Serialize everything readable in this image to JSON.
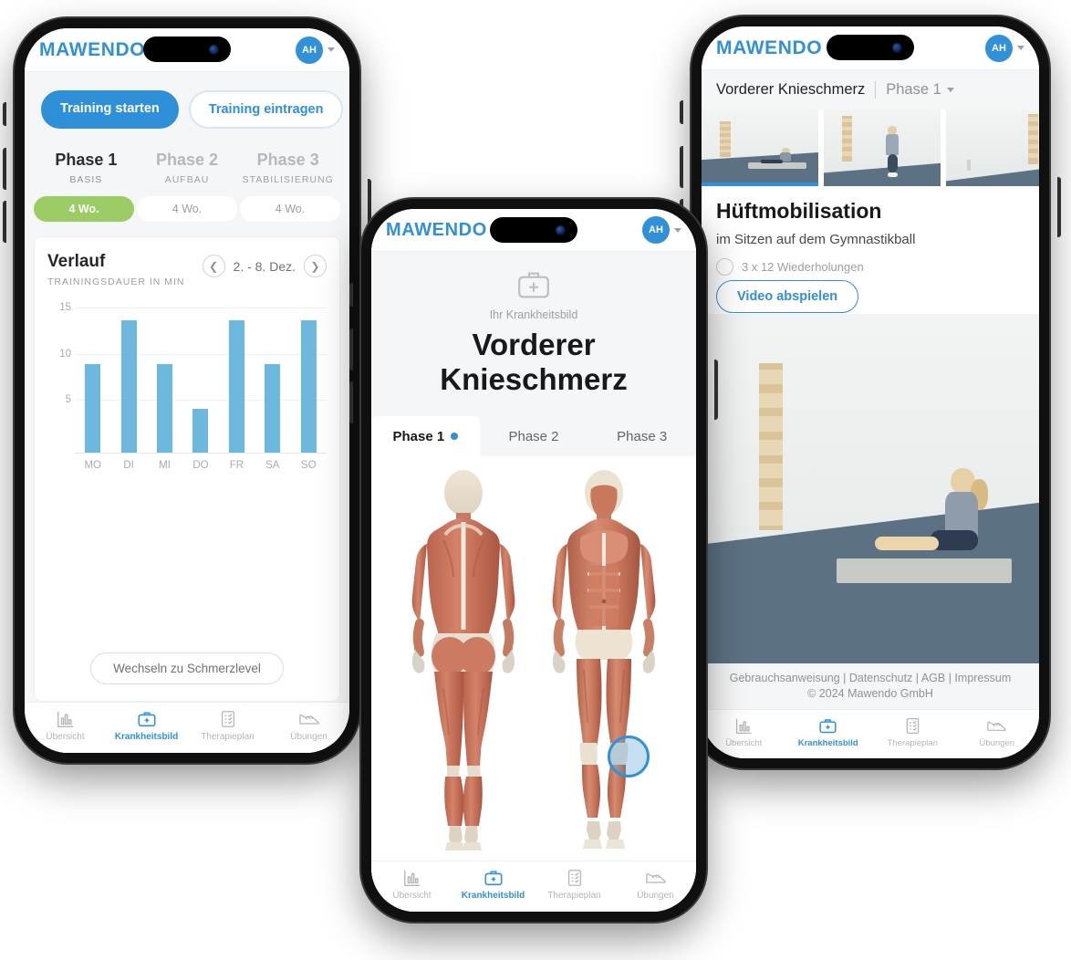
{
  "brand": "MAWENDO",
  "avatar": {
    "initials": "AH"
  },
  "colors": {
    "primary": "#2f8fd9",
    "brand_blue": "#3091d8",
    "green": "#9ccc65",
    "bar_blue": "#6cb8de",
    "muted": "#9aa0a6"
  },
  "nav": {
    "items": [
      {
        "label": "Übersicht",
        "icon": "bar-chart-icon",
        "active": false
      },
      {
        "label": "Krankheitsbild",
        "icon": "medical-bag-icon",
        "active": true
      },
      {
        "label": "Therapieplan",
        "icon": "clipboard-checklist-icon",
        "active": false
      },
      {
        "label": "Übungen",
        "icon": "running-shoe-icon",
        "active": false
      }
    ]
  },
  "phone1": {
    "cta": {
      "primary_label": "Training starten",
      "secondary_label": "Training eintragen"
    },
    "phases": [
      {
        "title": "Phase 1",
        "subtitle": "BASIS",
        "weeks": "4 Wo.",
        "active": true
      },
      {
        "title": "Phase 2",
        "subtitle": "AUFBAU",
        "weeks": "4 Wo.",
        "active": false
      },
      {
        "title": "Phase 3",
        "subtitle": "STABILISIERUNG",
        "weeks": "4 Wo.",
        "active": false
      }
    ],
    "card": {
      "title": "Verlauf",
      "subtitle": "TRAININGSDAUER IN MIN",
      "date_range": "2. - 8. Dez.",
      "prev_icon": "chevron-left-icon",
      "next_icon": "chevron-right-icon",
      "switch_label": "Wechseln zu Schmerzlevel"
    }
  },
  "chart_data": {
    "type": "bar",
    "title": "Verlauf",
    "subtitle": "TRAININGSDAUER IN MIN",
    "categories": [
      "MO",
      "DI",
      "MI",
      "DO",
      "FR",
      "SA",
      "SO"
    ],
    "values": [
      10,
      15,
      10,
      5,
      15,
      10,
      15
    ],
    "yticks": [
      5,
      10,
      15
    ],
    "ylim": [
      0,
      16.5
    ],
    "xlabel": "",
    "ylabel": "TRAININGSDAUER IN MIN",
    "grid": true,
    "legend": "none",
    "series_color": "#6cb8de",
    "date_range": "2. - 8. Dez."
  },
  "phone2": {
    "hero": {
      "icon": "medical-bag-icon",
      "kicker": "Ihr Krankheitsbild",
      "title_line1": "Vorderer",
      "title_line2": "Knieschmerz"
    },
    "tabs": [
      {
        "label": "Phase 1",
        "active": true
      },
      {
        "label": "Phase 2",
        "active": false
      },
      {
        "label": "Phase 3",
        "active": false
      }
    ],
    "anatomy": {
      "back_view_alt": "Rückansicht Muskulatur",
      "front_view_alt": "Vorderansicht Muskulatur",
      "marker": "knie-markierung"
    }
  },
  "phone3": {
    "breadcrumb": {
      "condition": "Vorderer Knieschmerz",
      "phase": "Phase 1",
      "caret_icon": "chevron-down-icon"
    },
    "thumbnails": [
      {
        "alt": "Übung sitzend auf Matte",
        "selected": true
      },
      {
        "alt": "Übung stehend",
        "selected": false
      },
      {
        "alt": "Übung Raumansicht",
        "selected": false
      }
    ],
    "exercise": {
      "title": "Hüftmobilisation",
      "subtitle": "im Sitzen auf dem Gymnastikball",
      "reps": "3 x 12 Wiederholungen",
      "video_button": "Video abspielen",
      "video_alt": "Frau sitzt auf Matte vor Sprossenwand"
    },
    "footer": {
      "links": "Gebrauchsanweisung  |  Datenschutz  |  AGB  |  Impressum",
      "copyright": "© 2024 Mawendo GmbH"
    }
  }
}
